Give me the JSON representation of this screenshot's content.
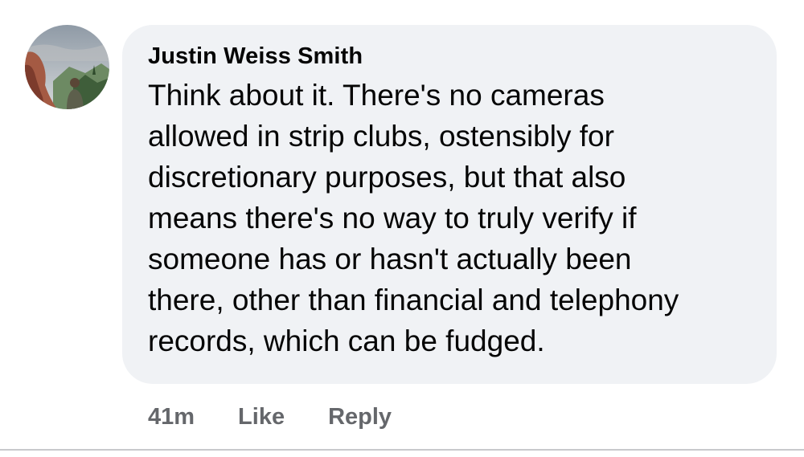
{
  "comment": {
    "author": "Justin Weiss Smith",
    "text": "Think about it. There's no cameras\nallowed in strip clubs, ostensibly for\ndiscretionary purposes, but that also\nmeans there's no way to truly verify if\nsomeone has or hasn't actually been\nthere, other than financial and telephony\nrecords, which can be fudged.",
    "avatar_icon": "profile-photo-outdoor"
  },
  "actions": {
    "time": "41m",
    "like_label": "Like",
    "reply_label": "Reply"
  },
  "colors": {
    "bubble_bg": "#f0f2f5",
    "action_text": "#65676b",
    "text": "#050505"
  }
}
